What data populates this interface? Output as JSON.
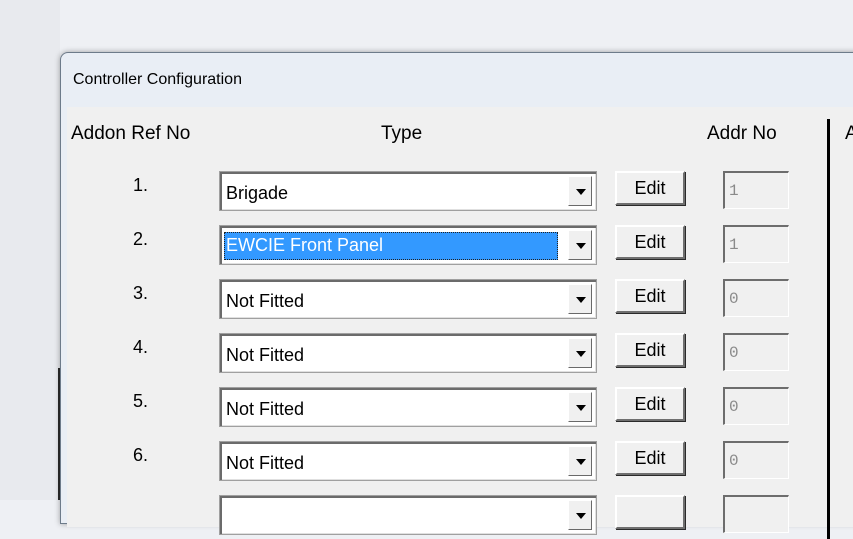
{
  "window": {
    "title": "Controller Configuration"
  },
  "headers": {
    "ref": "Addon Ref No",
    "type": "Type",
    "addr": "Addr No",
    "extra": "A"
  },
  "rows": [
    {
      "num": "1.",
      "type": "Brigade",
      "edit": "Edit",
      "addr": "1",
      "selected": false
    },
    {
      "num": "2.",
      "type": "EWCIE Front Panel",
      "edit": "Edit",
      "addr": "1",
      "selected": true
    },
    {
      "num": "3.",
      "type": "Not Fitted",
      "edit": "Edit",
      "addr": "0",
      "selected": false
    },
    {
      "num": "4.",
      "type": "Not Fitted",
      "edit": "Edit",
      "addr": "0",
      "selected": false
    },
    {
      "num": "5.",
      "type": "Not Fitted",
      "edit": "Edit",
      "addr": "0",
      "selected": false
    },
    {
      "num": "6.",
      "type": "Not Fitted",
      "edit": "Edit",
      "addr": "0",
      "selected": false
    }
  ],
  "colors": {
    "selection": "#3399ff",
    "window_bg": "#f0f0f0"
  }
}
